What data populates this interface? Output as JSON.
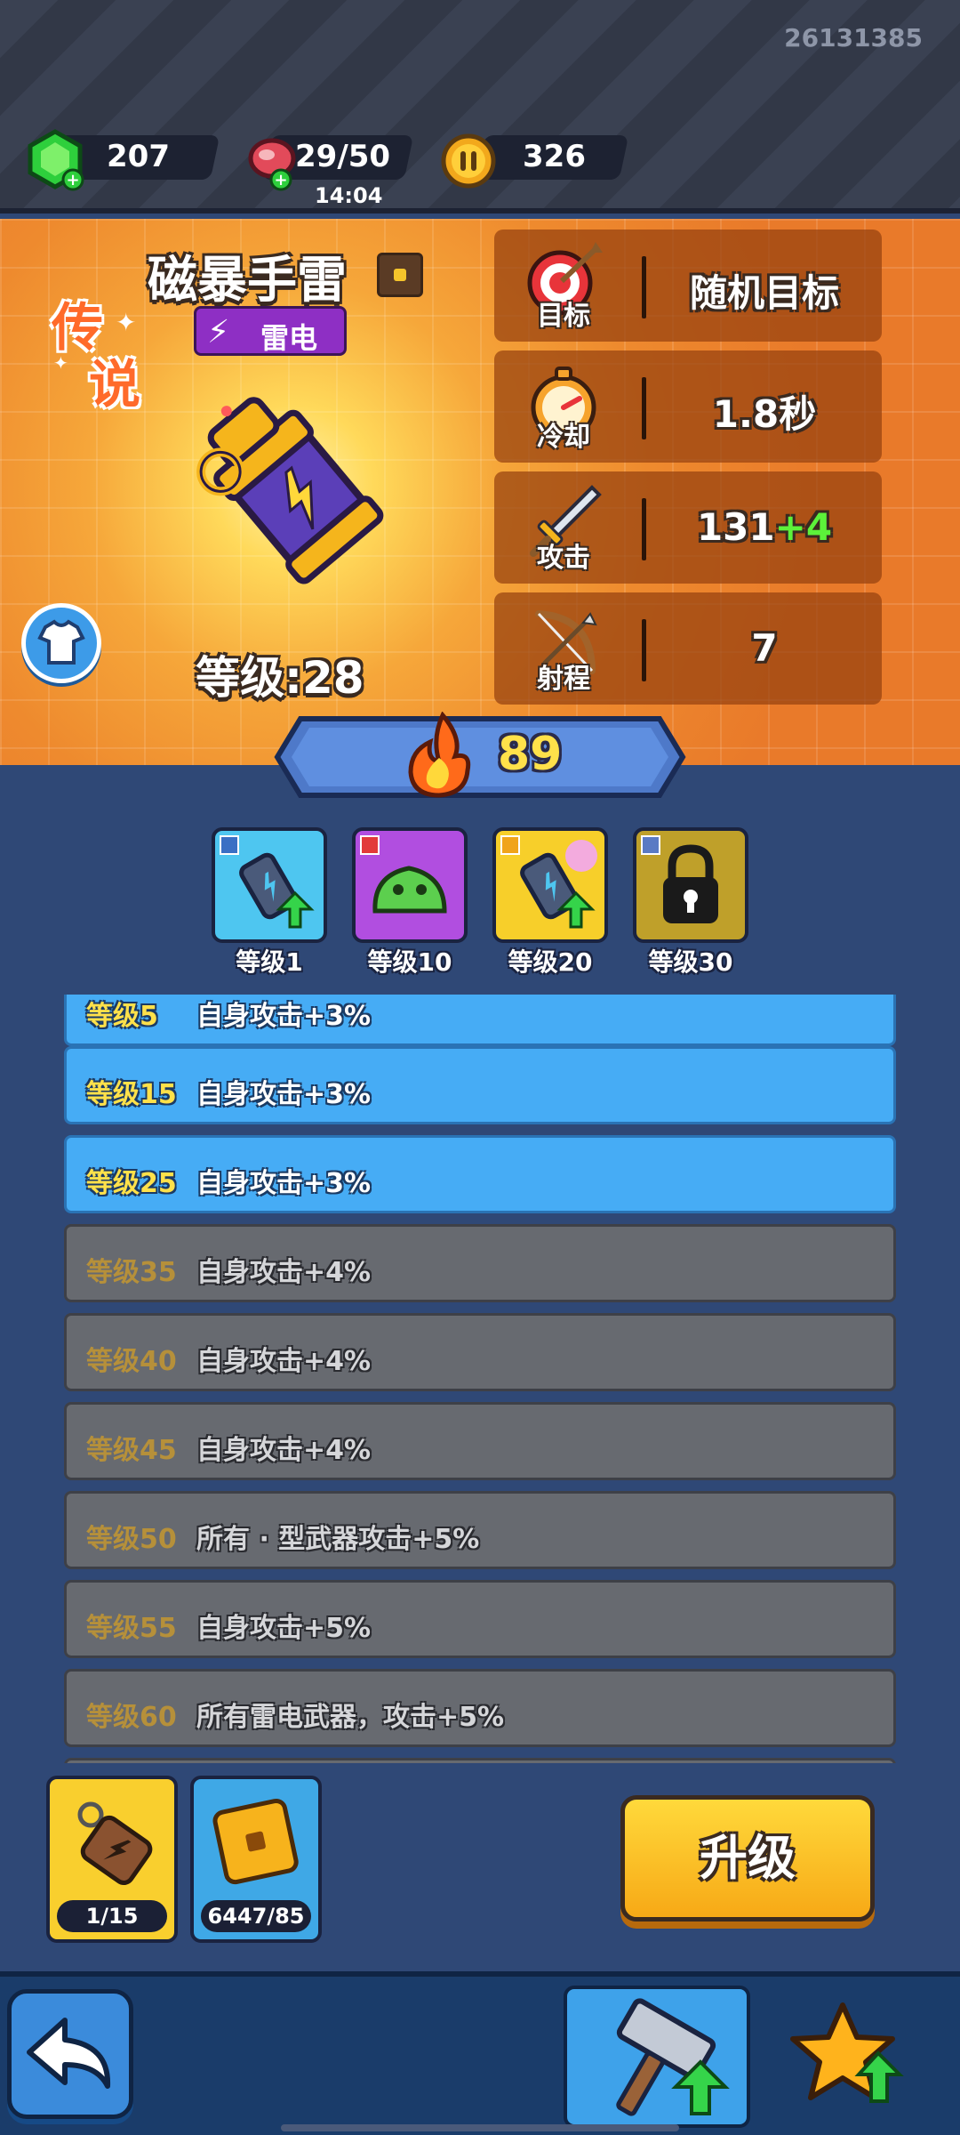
{
  "header": {
    "user_id": "26131385",
    "gems": "207",
    "stamina": "29/50",
    "stamina_timer": "14:04",
    "coins": "326"
  },
  "weapon": {
    "name": "磁暴手雷",
    "element": "雷电",
    "rarity_chars": [
      "传",
      "说"
    ],
    "level_text": "等级:28",
    "stats": [
      {
        "label": "目标",
        "value": "随机目标",
        "bonus": "",
        "icon": "target-icon"
      },
      {
        "label": "冷却",
        "value": "1.8秒",
        "bonus": "",
        "icon": "stopwatch-icon"
      },
      {
        "label": "攻击",
        "value": "131",
        "bonus": "+4",
        "icon": "sword-icon"
      },
      {
        "label": "射程",
        "value": "7",
        "bonus": "",
        "icon": "bow-icon"
      }
    ]
  },
  "power": "89",
  "skills": [
    {
      "label": "等级1",
      "icon": "grenade-upgrade-icon"
    },
    {
      "label": "等级10",
      "icon": "slime-icon"
    },
    {
      "label": "等级20",
      "icon": "grenade-charge-icon"
    },
    {
      "label": "等级30",
      "icon": "locked-icon"
    }
  ],
  "level_bonuses": [
    {
      "level": "等级5",
      "desc": "自身攻击+3%",
      "unlocked": true
    },
    {
      "level": "等级15",
      "desc": "自身攻击+3%",
      "unlocked": true
    },
    {
      "level": "等级25",
      "desc": "自身攻击+3%",
      "unlocked": true
    },
    {
      "level": "等级35",
      "desc": "自身攻击+4%",
      "unlocked": false
    },
    {
      "level": "等级40",
      "desc": "自身攻击+4%",
      "unlocked": false
    },
    {
      "level": "等级45",
      "desc": "自身攻击+4%",
      "unlocked": false
    },
    {
      "level": "等级50",
      "desc": "所有 · 型武器攻击+5%",
      "unlocked": false
    },
    {
      "level": "等级55",
      "desc": "自身攻击+5%",
      "unlocked": false
    },
    {
      "level": "等级60",
      "desc": "所有雷电武器，攻击+5%",
      "unlocked": false
    }
  ],
  "materials": [
    {
      "count": "1/15",
      "icon": "blueprint-tag-icon"
    },
    {
      "count": "6447/85",
      "icon": "material-cube-icon"
    }
  ],
  "upgrade_label": "升级",
  "colors": {
    "accent_yellow": "#f7a916",
    "unlocked_row": "#46acf5",
    "locked_row": "#676a70",
    "bonus_green": "#5cf23a"
  }
}
